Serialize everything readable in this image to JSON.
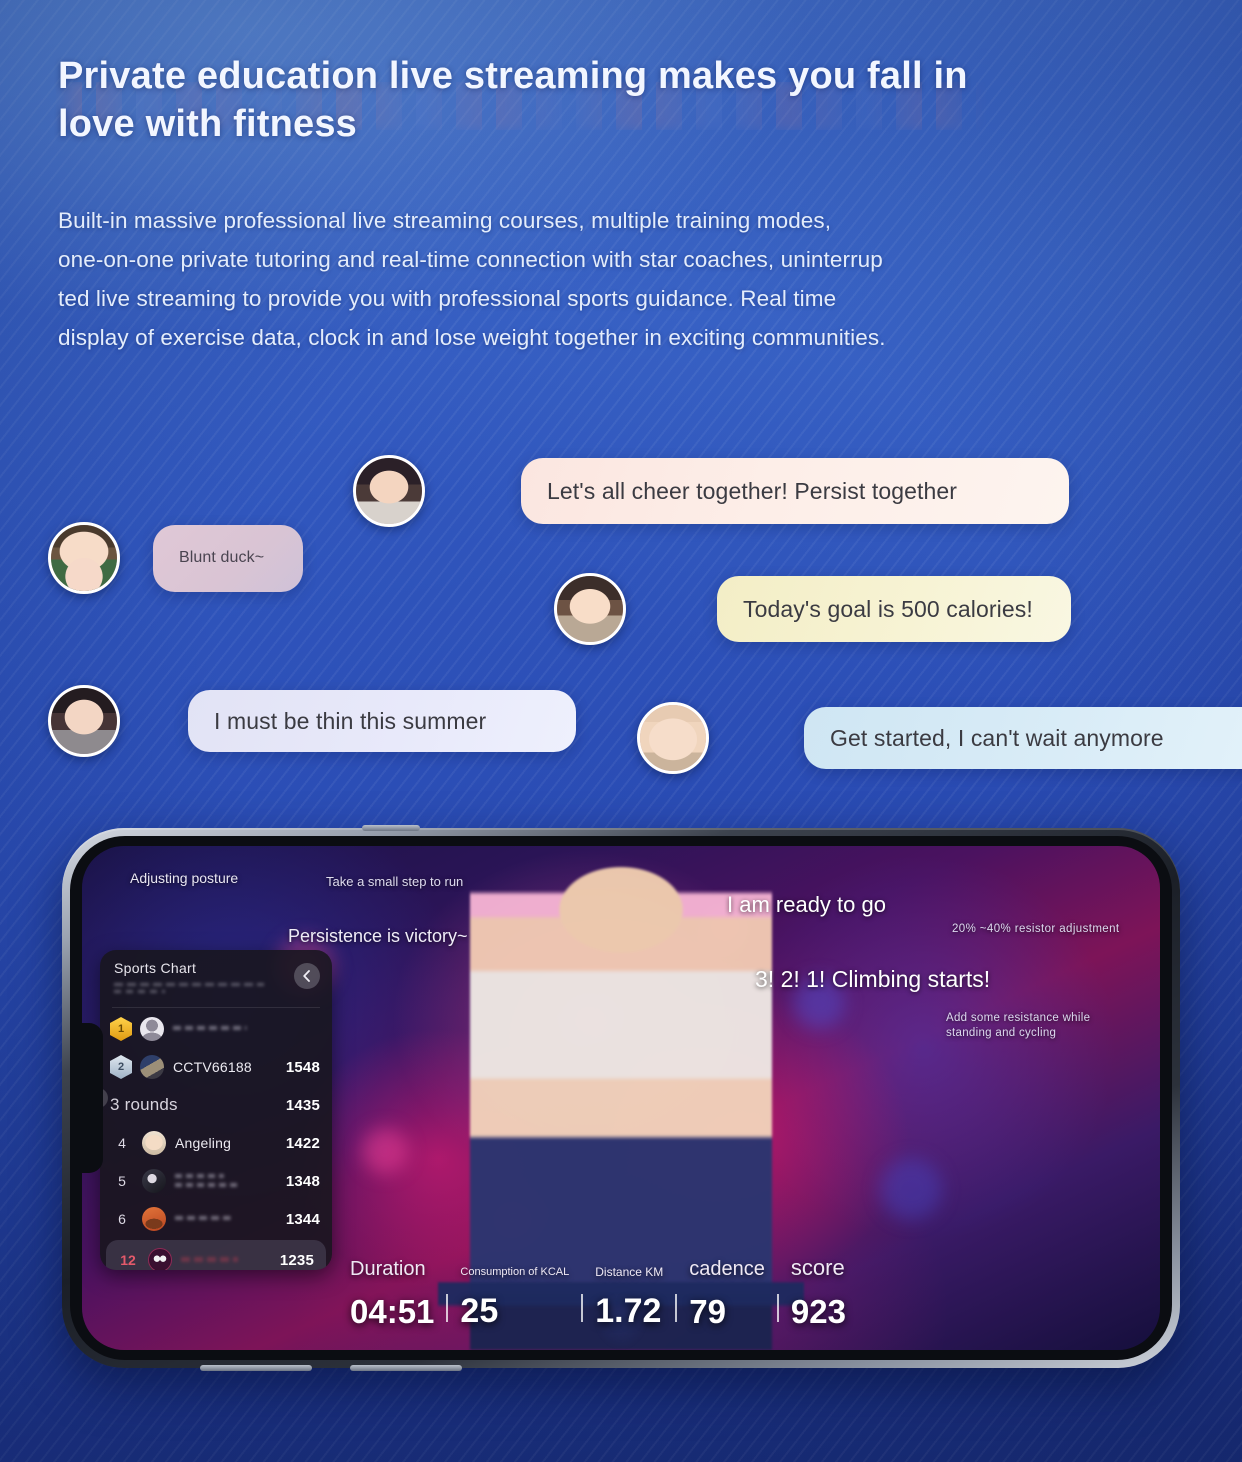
{
  "hero": {
    "headline": "Private education live streaming makes you fall in love with fitness",
    "body": "Built-in massive professional live streaming courses, multiple training modes,\none-on-one private tutoring and real-time connection with star coaches, uninterrup\nted live streaming to provide you with professional sports guidance. Real time\ndisplay of exercise data, clock in and lose weight together in exciting communities."
  },
  "chat": {
    "messages": [
      {
        "id": "blunt-duck",
        "text": "Blunt duck~"
      },
      {
        "id": "cheer",
        "text": "Let's all cheer together! Persist together"
      },
      {
        "id": "goal",
        "text": "Today's goal is 500 calories!"
      },
      {
        "id": "thin-summer",
        "text": "I must be thin this summer"
      },
      {
        "id": "get-started",
        "text": "Get started, I can't wait anymore"
      }
    ]
  },
  "phone": {
    "overlays": {
      "adjusting_posture": "Adjusting posture",
      "small_step": "Take a small step to run",
      "persistence": "Persistence is victory~",
      "ready": "I am ready to go",
      "resistor": "20% ~40% resistor adjustment",
      "climbing": "3! 2! 1! Climbing starts!",
      "add_resistance": "Add some resistance while standing and cycling"
    },
    "sports_chart": {
      "title": "Sports Chart",
      "subtitle": "",
      "back_icon": "chevron-left-icon",
      "rows": [
        {
          "rank": "1",
          "badge": "gold",
          "name": "",
          "score": "",
          "avatar": "default",
          "blurred": true,
          "style": "short"
        },
        {
          "rank": "2",
          "badge": "silver",
          "name": "CCTV66188",
          "score": "1548",
          "avatar": "img2",
          "blurred": false,
          "style": ""
        },
        {
          "rank": "3",
          "badge": "",
          "name": "3 rounds",
          "score": "1435",
          "avatar": "",
          "blurred": false,
          "style": "rounds"
        },
        {
          "rank": "4",
          "badge": "",
          "name": "Angeling",
          "score": "1422",
          "avatar": "img4",
          "blurred": false,
          "style": ""
        },
        {
          "rank": "5",
          "badge": "",
          "name": "",
          "score": "1348",
          "avatar": "img5",
          "blurred": true,
          "style": "two-line"
        },
        {
          "rank": "6",
          "badge": "",
          "name": "",
          "score": "1344",
          "avatar": "img6",
          "blurred": true,
          "style": "short"
        },
        {
          "rank": "12",
          "badge": "",
          "name": "",
          "score": "1235",
          "avatar": "img12",
          "blurred": true,
          "style": "redacted",
          "me": true
        }
      ]
    },
    "stats": [
      {
        "id": "duration",
        "label": "Duration",
        "value": "04:51"
      },
      {
        "id": "kcal",
        "label": "Consumption of KCAL",
        "value": "25"
      },
      {
        "id": "distance",
        "label": "Distance KM",
        "value": "1.72"
      },
      {
        "id": "cadence",
        "label": "cadence",
        "value": "79"
      },
      {
        "id": "score",
        "label": "score",
        "value": "923"
      }
    ]
  },
  "colors": {
    "background_top": "#4a78d0",
    "background_bottom": "#192d78",
    "headline": "#f2f6ff",
    "bubble_pink": "#fbe6e0",
    "bubble_mauve": "#e0c8d6",
    "bubble_cream": "#f3eec6",
    "bubble_lavender": "#e2e3f5",
    "bubble_ice": "#cfe6f3",
    "my_rank": "#e45a6b",
    "badge_gold": "#ffd24a",
    "badge_silver": "#dfe7ef"
  }
}
